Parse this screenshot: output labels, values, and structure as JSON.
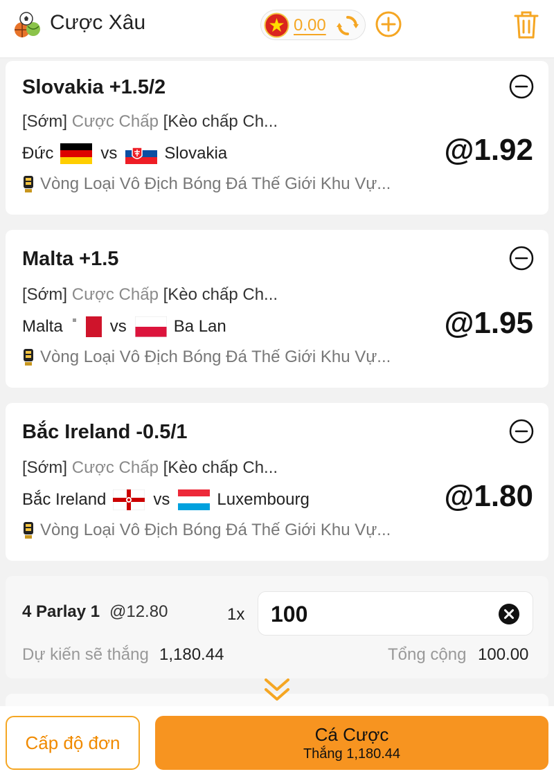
{
  "header": {
    "title": "Cược Xâu",
    "logo_icon": "sports-balls-icon",
    "balance": "0.00",
    "currency_flag": "vietnam-flag-icon",
    "refresh_icon": "refresh-icon",
    "add_icon": "plus-circle-icon",
    "delete_icon": "trash-icon",
    "accent_color": "#f5a623"
  },
  "bets": [
    {
      "title": "Slovakia +1.5/2",
      "tag": "[Sớm]",
      "market": "Cược Chấp",
      "market_detail": "[Kèo chấp Ch...",
      "home": "Đức",
      "vs": "vs",
      "away": "Slovakia",
      "home_flag": "germany-flag",
      "away_flag": "slovakia-flag",
      "odds": "@1.92",
      "league": "Vòng Loại Vô Địch Bóng Đá Thế Giới Khu Vự..."
    },
    {
      "title": "Malta +1.5",
      "tag": "[Sớm]",
      "market": "Cược Chấp",
      "market_detail": "[Kèo chấp Ch...",
      "home": "Malta",
      "vs": "vs",
      "away": "Ba Lan",
      "home_flag": "malta-flag",
      "away_flag": "poland-flag",
      "odds": "@1.95",
      "league": "Vòng Loại Vô Địch Bóng Đá Thế Giới Khu Vự..."
    },
    {
      "title": "Bắc Ireland -0.5/1",
      "tag": "[Sớm]",
      "market": "Cược Chấp",
      "market_detail": "[Kèo chấp Ch...",
      "home": "Bắc Ireland",
      "vs": "vs",
      "away": "Luxembourg",
      "home_flag": "northern-ireland-flag",
      "away_flag": "luxembourg-flag",
      "odds": "@1.80",
      "league": "Vòng Loại Vô Địch Bóng Đá Thế Giới Khu Vự..."
    }
  ],
  "parlay": {
    "label": "4 Parlay 1",
    "odds": "@12.80",
    "multiplier": "1x",
    "stake": "100",
    "expected_win_label": "Dự kiến sẽ thắng",
    "expected_win_value": "1,180.44",
    "total_label": "Tổng cộng",
    "total_value": "100.00"
  },
  "footer": {
    "level_button": "Cấp độ đơn",
    "bet_button_title": "Cá Cược",
    "bet_button_sub": "Thắng 1,180.44",
    "button_color": "#f79420"
  }
}
